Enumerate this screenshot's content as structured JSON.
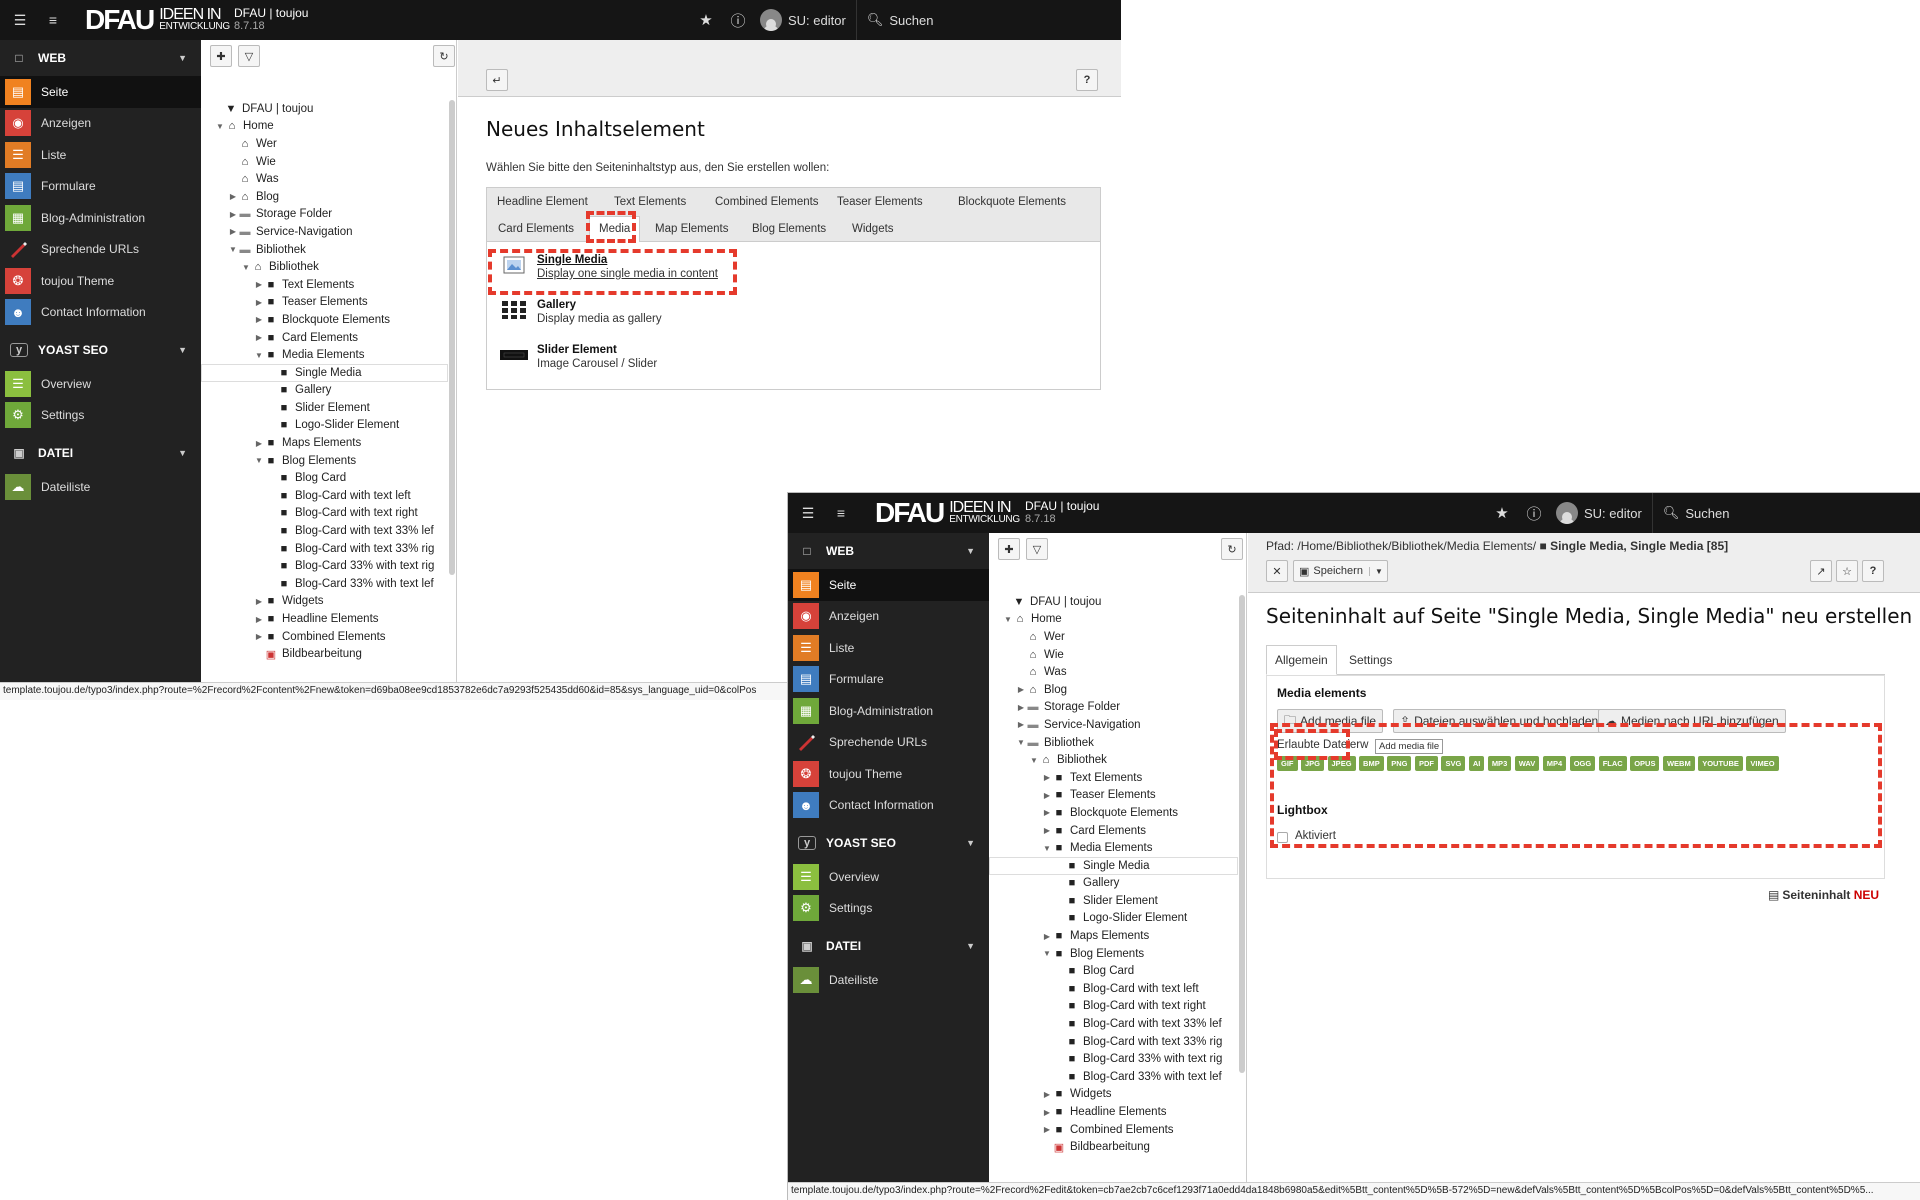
{
  "app": {
    "logo_main": "DFAU",
    "logo_sub_top": "IDEEN IN",
    "logo_sub_bottom": "ENTWICKLUNG",
    "site_name": "DFAU | toujou",
    "version": "8.7.18",
    "user": "SU: editor",
    "search_label": "Suchen"
  },
  "modules": {
    "web": "WEB",
    "seite": "Seite",
    "anzeigen": "Anzeigen",
    "liste": "Liste",
    "formulare": "Formulare",
    "blog": "Blog-Administration",
    "urls": "Sprechende URLs",
    "theme": "toujou Theme",
    "contact": "Contact Information",
    "yoast": "YOAST SEO",
    "overview": "Overview",
    "settings": "Settings",
    "datei": "DATEI",
    "dateiliste": "Dateiliste"
  },
  "colors": {
    "seite": "#f08220",
    "anzeigen": "#d6423a",
    "liste": "#e17c25",
    "formulare": "#3f7cbf",
    "blog": "#6fa83a",
    "urls": "#222222",
    "theme": "#d6423a",
    "contact": "#3f7cbf",
    "yoast": "#222222",
    "overview": "#8bbf3f",
    "settings": "#6fa83a",
    "datei": "#222222",
    "dateiliste": "#6a8f3a",
    "highlight": "#e53a2c",
    "badge": "#79a548"
  },
  "tree": [
    {
      "label": "DFAU | toujou",
      "level": 0,
      "toggle": "",
      "icon": "typo3"
    },
    {
      "label": "Home",
      "level": 1,
      "toggle": "down",
      "icon": "home"
    },
    {
      "label": "Wer",
      "level": 2,
      "toggle": "",
      "icon": "home"
    },
    {
      "label": "Wie",
      "level": 2,
      "toggle": "",
      "icon": "home"
    },
    {
      "label": "Was",
      "level": 2,
      "toggle": "",
      "icon": "home"
    },
    {
      "label": "Blog",
      "level": 2,
      "toggle": "right",
      "icon": "home"
    },
    {
      "label": "Storage Folder",
      "level": 2,
      "toggle": "right",
      "icon": "folder"
    },
    {
      "label": "Service-Navigation",
      "level": 2,
      "toggle": "right",
      "icon": "folder"
    },
    {
      "label": "Bibliothek",
      "level": 2,
      "toggle": "down",
      "icon": "folder"
    },
    {
      "label": "Bibliothek",
      "level": 3,
      "toggle": "down",
      "icon": "home"
    },
    {
      "label": "Text Elements",
      "level": 4,
      "toggle": "right",
      "icon": "page"
    },
    {
      "label": "Teaser Elements",
      "level": 4,
      "toggle": "right",
      "icon": "page"
    },
    {
      "label": "Blockquote Elements",
      "level": 4,
      "toggle": "right",
      "icon": "page"
    },
    {
      "label": "Card Elements",
      "level": 4,
      "toggle": "right",
      "icon": "page"
    },
    {
      "label": "Media Elements",
      "level": 4,
      "toggle": "down",
      "icon": "page"
    },
    {
      "label": "Single Media",
      "level": 5,
      "toggle": "",
      "icon": "page",
      "selected": true
    },
    {
      "label": "Gallery",
      "level": 5,
      "toggle": "",
      "icon": "page"
    },
    {
      "label": "Slider Element",
      "level": 5,
      "toggle": "",
      "icon": "page"
    },
    {
      "label": "Logo-Slider Element",
      "level": 5,
      "toggle": "",
      "icon": "page"
    },
    {
      "label": "Maps Elements",
      "level": 4,
      "toggle": "right",
      "icon": "page"
    },
    {
      "label": "Blog Elements",
      "level": 4,
      "toggle": "down",
      "icon": "page"
    },
    {
      "label": "Blog Card",
      "level": 5,
      "toggle": "",
      "icon": "page"
    },
    {
      "label": "Blog-Card with text left",
      "level": 5,
      "toggle": "",
      "icon": "page"
    },
    {
      "label": "Blog-Card with text right",
      "level": 5,
      "toggle": "",
      "icon": "page"
    },
    {
      "label": "Blog-Card with text 33% lef",
      "level": 5,
      "toggle": "",
      "icon": "page"
    },
    {
      "label": "Blog-Card with text 33% rig",
      "level": 5,
      "toggle": "",
      "icon": "page"
    },
    {
      "label": "Blog-Card 33% with text rig",
      "level": 5,
      "toggle": "",
      "icon": "page"
    },
    {
      "label": "Blog-Card 33% with text lef",
      "level": 5,
      "toggle": "",
      "icon": "page"
    },
    {
      "label": "Widgets",
      "level": 4,
      "toggle": "right",
      "icon": "page"
    },
    {
      "label": "Headline Elements",
      "level": 4,
      "toggle": "right",
      "icon": "page"
    },
    {
      "label": "Combined Elements",
      "level": 4,
      "toggle": "right",
      "icon": "page"
    },
    {
      "label": "Bildbearbeitung",
      "level": 4,
      "toggle": "",
      "icon": "special"
    }
  ],
  "wizard": {
    "title": "Neues Inhaltselement",
    "intro": "Wählen Sie bitte den Seiteninhaltstyp aus, den Sie erstellen wollen:",
    "tabs_row1": [
      "Headline Element",
      "Text Elements",
      "Combined Elements",
      "Teaser Elements",
      "Blockquote Elements"
    ],
    "tabs_row2": [
      "Card Elements",
      "Media",
      "Map Elements",
      "Blog Elements",
      "Widgets"
    ],
    "active_tab": "Media",
    "items": [
      {
        "title": "Single Media",
        "desc": "Display one single media in content"
      },
      {
        "title": "Gallery",
        "desc": "Display media as gallery"
      },
      {
        "title": "Slider Element",
        "desc": "Image Carousel / Slider"
      }
    ],
    "status_url": "template.toujou.de/typo3/index.php?route=%2Frecord%2Fcontent%2Fnew&token=d69ba08ee9cd1853782e6dc7a9293f525435dd60&id=85&sys_language_uid=0&colPos"
  },
  "editor": {
    "path_prefix": "Pfad: /Home/Bibliothek/Bibliothek/Media Elements/",
    "path_record": "Single Media, Single Media [85]",
    "save_label": "Speichern",
    "title": "Seiteninhalt auf Seite \"Single Media, Single Media\" neu erstellen",
    "tabs": [
      "Allgemein",
      "Settings"
    ],
    "section_media": "Media elements",
    "btn_add": "Add media file",
    "btn_upload": "Dateien auswählen und hochladen",
    "btn_url": "Medien nach URL hinzufügen",
    "allowed_label": "Erlaubte Dateierw",
    "tooltip": "Add media file",
    "badges": [
      "GIF",
      "JPG",
      "JPEG",
      "BMP",
      "PNG",
      "PDF",
      "SVG",
      "AI",
      "MP3",
      "WAV",
      "MP4",
      "OGG",
      "FLAC",
      "OPUS",
      "WEBM",
      "YOUTUBE",
      "VIMEO"
    ],
    "section_lightbox": "Lightbox",
    "lightbox_check": "Aktiviert",
    "footer_label": "Seiteninhalt",
    "footer_new": "NEU",
    "status_url": "template.toujou.de/typo3/index.php?route=%2Frecord%2Fedit&token=cb7ae2cb7c6cef1293f71a0edd4da1848b6980a5&edit%5Btt_content%5D%5B-572%5D=new&defVals%5Btt_content%5D%5BcolPos%5D=0&defVals%5Btt_content%5D%5..."
  }
}
